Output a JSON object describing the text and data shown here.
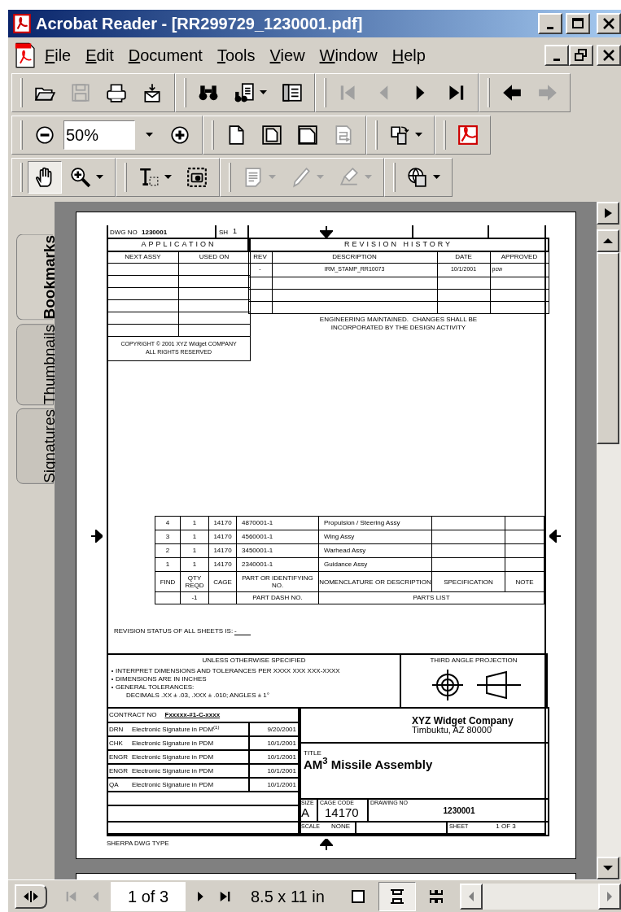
{
  "window": {
    "title": "Acrobat Reader - [RR299729_1230001.pdf]"
  },
  "menu": [
    "File",
    "Edit",
    "Document",
    "Tools",
    "View",
    "Window",
    "Help"
  ],
  "toolbars": [
    [
      [
        {
          "kind": "open",
          "disabled": false
        },
        {
          "kind": "save",
          "disabled": true
        },
        {
          "kind": "print",
          "disabled": false
        },
        {
          "kind": "email",
          "disabled": false
        }
      ],
      [
        {
          "kind": "find",
          "disabled": false
        },
        {
          "kind": "search",
          "disabled": false,
          "caret": true
        },
        {
          "kind": "pane",
          "disabled": false
        }
      ],
      [
        {
          "kind": "first",
          "disabled": true
        },
        {
          "kind": "prev",
          "disabled": true
        },
        {
          "kind": "next",
          "disabled": false
        },
        {
          "kind": "last",
          "disabled": false
        }
      ],
      [
        {
          "kind": "back",
          "disabled": false
        },
        {
          "kind": "forward",
          "disabled": true
        }
      ]
    ],
    [
      [
        {
          "kind": "zoom-out",
          "disabled": false
        },
        {
          "kind": "zoom-field",
          "value": "50%",
          "disabled": false
        },
        {
          "kind": "zoom-in",
          "disabled": false
        }
      ],
      [
        {
          "kind": "actual",
          "disabled": false
        },
        {
          "kind": "fit-page",
          "disabled": false
        },
        {
          "kind": "fit-width",
          "disabled": false
        },
        {
          "kind": "reflow",
          "disabled": true
        }
      ],
      [
        {
          "kind": "rotate",
          "disabled": false,
          "caret": true
        }
      ],
      [
        {
          "kind": "acrobat",
          "disabled": false
        }
      ]
    ],
    [
      [
        {
          "kind": "hand",
          "disabled": false,
          "selected": true
        },
        {
          "kind": "zoom-tool",
          "disabled": false,
          "selected": false,
          "caret": true
        }
      ],
      [
        {
          "kind": "text-select",
          "disabled": false,
          "selected": false,
          "caret": true
        },
        {
          "kind": "snapshot",
          "disabled": false,
          "selected": false
        }
      ],
      [
        {
          "kind": "note",
          "disabled": true,
          "selected": false,
          "caret": true
        },
        {
          "kind": "pencil",
          "disabled": true,
          "selected": false,
          "caret": true
        },
        {
          "kind": "highlighter",
          "disabled": true,
          "selected": false,
          "caret": true
        }
      ],
      [
        {
          "kind": "web",
          "disabled": false,
          "selected": false,
          "caret": true
        }
      ]
    ]
  ],
  "side_tabs": [
    {
      "label": "Bookmarks",
      "selected": true
    },
    {
      "label": "Thumbnails",
      "selected": false
    },
    {
      "label": "Signatures",
      "selected": false
    }
  ],
  "drawing": {
    "dwg_no": {
      "label": "DWG NO",
      "value": "1230001"
    },
    "sh": {
      "label": "SH",
      "value": "1"
    },
    "application": {
      "title": "APPLICATION",
      "columns": [
        "NEXT ASSY",
        "USED ON"
      ]
    },
    "copyright": [
      "COPYRIGHT © 2001 XYZ Widget COMPANY",
      "ALL RIGHTS RESERVED"
    ],
    "revision_history": {
      "title": "REVISION HISTORY",
      "columns": [
        "REV",
        "DESCRIPTION",
        "DATE",
        "APPROVED"
      ],
      "rows": [
        [
          "-",
          "IRM_STAMP_RR10073",
          "10/1/2001",
          "pcw"
        ]
      ]
    },
    "note": [
      "ENGINEERING MAINTAINED.  CHANGES SHALL BE",
      "INCORPORATED BY THE DESIGN ACTIVITY"
    ],
    "parts_list": {
      "rows": [
        [
          "4",
          "1",
          "14170",
          "4870001-1",
          "Propulsion / Steering Assy"
        ],
        [
          "3",
          "1",
          "14170",
          "4560001-1",
          "Wing Assy"
        ],
        [
          "2",
          "1",
          "14170",
          "3450001-1",
          "Warhead Assy"
        ],
        [
          "1",
          "1",
          "14170",
          "2340001-1",
          "Guidance Assy"
        ]
      ],
      "header": [
        "FIND",
        "QTY REQD",
        "CAGE",
        "PART OR IDENTIFYING NO.",
        "NOMENCLATURE OR DESCRIPTION",
        "SPECIFICATION",
        "NOTE"
      ],
      "footer": {
        "qty": "-1",
        "part": "PART DASH NO.",
        "title": "PARTS LIST"
      }
    },
    "revision_status": {
      "label": "REVISION STATUS OF ALL SHEETS IS:",
      "value": "-"
    },
    "tolerances": {
      "title": "UNLESS OTHERWISE SPECIFIED",
      "bullets": [
        "INTERPRET DIMENSIONS AND TOLERANCES PER XXXX XXX XXX-XXXX",
        "DIMENSIONS ARE IN INCHES",
        "GENERAL TOLERANCES:"
      ],
      "detail": "DECIMALS .XX ± .03, .XXX ± .010; ANGLES ± 1°"
    },
    "projection": {
      "title": "THIRD ANGLE PROJECTION"
    },
    "contract": {
      "label": "CONTRACT NO",
      "value": "Fxxxxx-#1-C-xxxx"
    },
    "signatures": [
      {
        "role": "DRN",
        "name": "Electronic Signature in PDM$^{(1)}$",
        "date": "9/20/2001"
      },
      {
        "role": "CHK",
        "name": "Electronic Signature in PDM",
        "date": "10/1/2001"
      },
      {
        "role": "ENGR",
        "name": "Electronic Signature in PDM",
        "date": "10/1/2001"
      },
      {
        "role": "ENGR",
        "name": "Electronic Signature in PDM",
        "date": "10/1/2001"
      },
      {
        "role": "QA",
        "name": "Electronic Signature in PDM",
        "date": "10/1/2001"
      }
    ],
    "company": {
      "name": "XYZ Widget Company",
      "address": "Timbuktu, AZ 80000"
    },
    "title": {
      "label": "TITLE",
      "value": "AM$^{3}$ Missile Assembly"
    },
    "size": {
      "label": "SIZE",
      "value": "A"
    },
    "cage_code": {
      "label": "CAGE CODE",
      "value": "14170"
    },
    "drawing_no": {
      "label": "DRAWING NO",
      "value": "1230001"
    },
    "scale": {
      "label": "SCALE",
      "value": "NONE"
    },
    "sheet": {
      "label": "SHEET",
      "value": "1 OF 3"
    },
    "footer": "SHERPA DWG TYPE"
  },
  "status_bar": {
    "page": "1 of 3",
    "page_size": "8.5 x 11 in",
    "nav": [
      {
        "kind": "first",
        "disabled": true
      },
      {
        "kind": "prev",
        "disabled": true
      },
      {
        "kind": "next",
        "disabled": false
      },
      {
        "kind": "last",
        "disabled": false
      }
    ],
    "views": [
      {
        "kind": "single",
        "selected": false
      },
      {
        "kind": "continuous",
        "selected": true
      },
      {
        "kind": "facing",
        "selected": false
      }
    ]
  }
}
